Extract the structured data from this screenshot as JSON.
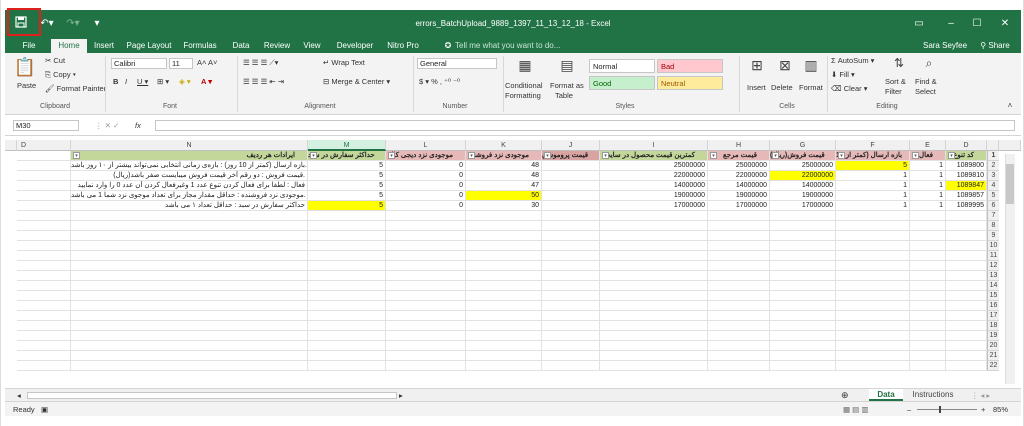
{
  "window": {
    "title": "errors_BatchUpload_9889_1397_11_13_12_18 - Excel",
    "user": "Sara Seyfee",
    "share": "Share"
  },
  "tabs": [
    "File",
    "Home",
    "Insert",
    "Page Layout",
    "Formulas",
    "Data",
    "Review",
    "View",
    "Developer",
    "Nitro Pro"
  ],
  "tell_me": "Tell me what you want to do...",
  "ribbon": {
    "clipboard": {
      "paste": "Paste",
      "cut": "Cut",
      "copy": "Copy",
      "format_painter": "Format Painter",
      "label": "Clipboard"
    },
    "font": {
      "name": "Calibri",
      "size": "11",
      "label": "Font"
    },
    "alignment": {
      "wrap": "Wrap Text",
      "merge": "Merge & Center",
      "label": "Alignment"
    },
    "number": {
      "format": "General",
      "label": "Number"
    },
    "styles": {
      "conditional": "Conditional",
      "formatting": "Formatting",
      "format_as": "Format as",
      "table": "Table",
      "normal": "Normal",
      "bad": "Bad",
      "good": "Good",
      "neutral": "Neutral",
      "label": "Styles"
    },
    "cells": {
      "insert": "Insert",
      "delete": "Delete",
      "format": "Format",
      "label": "Cells"
    },
    "editing": {
      "autosum": "AutoSum",
      "fill": "Fill",
      "clear": "Clear",
      "sort": "Sort &",
      "filter": "Filter",
      "find": "Find &",
      "select": "Select",
      "label": "Editing"
    }
  },
  "formula_bar": {
    "name_box": "M30",
    "fx": "fx",
    "value": ""
  },
  "columns": [
    "N",
    "M",
    "L",
    "K",
    "J",
    "I",
    "H",
    "G",
    "F",
    "E",
    "D"
  ],
  "left_col": "D",
  "headers": {
    "D": "کد تنوع",
    "E": "فعال",
    "F": "بازه ارسال (کمتر از 10",
    "G": "(ریال)قیمت فروش",
    "H": "قیمت مرجع",
    "I": "کمترین قیمت محصول در سایت",
    "J": "قیمت پروموشن",
    "K": "موجودی نزد فروشند",
    "L": "موجودی نزد دیجی کالا",
    "M": "حداکثر سفارش در سبد",
    "N": "ایرادات هر ردیف"
  },
  "rows": [
    {
      "D": "1089800",
      "E": "1",
      "F": "5",
      "G": "25000000",
      "H": "25000000",
      "I": "25000000",
      "J": "",
      "K": "48",
      "L": "0",
      "M": "5",
      "N": "بازه ارسال (کمتر از 10 روز) : بازه‌ی زمانی انتخابی نمی‌تواند بیشتر از ۱۰ روز باشد."
    },
    {
      "D": "1089810",
      "E": "1",
      "F": "1",
      "G": "22000000",
      "H": "22000000",
      "I": "22000000",
      "J": "",
      "K": "48",
      "L": "0",
      "M": "5",
      "N": "(ریال)قیمت فروش : دو رقم آخر قیمت فروش میبایست صفر باشد."
    },
    {
      "D": "1089847",
      "E": "1",
      "F": "1",
      "G": "14000000",
      "H": "14000000",
      "I": "14000000",
      "J": "",
      "K": "47",
      "L": "0",
      "M": "5",
      "N": "فعال : لطفا برای فعال کردن تنوع عدد 1 وغیرفعال کردن آن عدد 0 را وارد نمایید"
    },
    {
      "D": "1089857",
      "E": "1",
      "F": "1",
      "G": "19000000",
      "H": "19000000",
      "I": "19000000",
      "J": "",
      "K": "50",
      "L": "0",
      "M": "5",
      "N": "موجودی نزد فروشنده : حداقل مقدار مجاز برای تعداد موجوی نزد شما 1 می باشد."
    },
    {
      "D": "1089995",
      "E": "1",
      "F": "1",
      "G": "17000000",
      "H": "17000000",
      "I": "17000000",
      "J": "",
      "K": "30",
      "L": "0",
      "M": "5",
      "N": "حداکثر سفارش در سبد : حداقل تعداد ۱ می باشد"
    }
  ],
  "row_numbers": [
    "1",
    "2",
    "3",
    "4",
    "5",
    "6",
    "7",
    "8",
    "9",
    "10",
    "11",
    "12",
    "13",
    "14",
    "15",
    "16",
    "17",
    "18",
    "19",
    "20",
    "21",
    "22"
  ],
  "sheets": {
    "active": "Data",
    "other": "Instructions"
  },
  "status": {
    "ready": "Ready",
    "zoom": "85%"
  },
  "colors": {
    "excel_green": "#217346",
    "yellow_highlight": "#ffff00",
    "header_green": "#c4d79b",
    "header_red": "#e6b8b7",
    "header_red_dark": "#d9a3a1"
  }
}
